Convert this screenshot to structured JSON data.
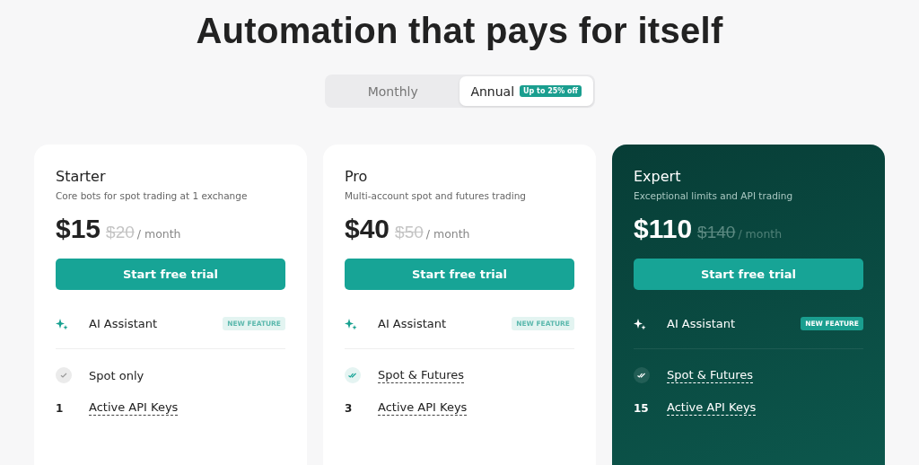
{
  "heading": "Automation that pays for itself",
  "billing": [
    {
      "label": "Monthly",
      "selected": false
    },
    {
      "label": "Annual",
      "selected": true,
      "badge": "Up to 25% off"
    }
  ],
  "plans": [
    {
      "name": "Starter",
      "tagline": "Core bots for spot trading at 1 exchange",
      "price": "$15",
      "old_price": "$20",
      "period": "/ month",
      "featured": false,
      "cta": "Start free trial",
      "ai": {
        "label": "AI Assistant",
        "badge": "NEW FEATURE"
      },
      "market": {
        "kind": "check",
        "label": "Spot only",
        "underlined": false
      },
      "keys": {
        "count": "1",
        "label": "Active API Keys"
      }
    },
    {
      "name": "Pro",
      "tagline": "Multi-account spot and futures trading",
      "price": "$40",
      "old_price": "$50",
      "period": "/ month",
      "featured": false,
      "cta": "Start free trial",
      "ai": {
        "label": "AI Assistant",
        "badge": "NEW FEATURE"
      },
      "market": {
        "kind": "double-check",
        "label": "Spot & Futures",
        "underlined": true
      },
      "keys": {
        "count": "3",
        "label": "Active API Keys"
      }
    },
    {
      "name": "Expert",
      "tagline": "Exceptional limits and API trading",
      "price": "$110",
      "old_price": "$140",
      "period": "/ month",
      "featured": true,
      "cta": "Start free trial",
      "ai": {
        "label": "AI Assistant",
        "badge": "NEW FEATURE"
      },
      "market": {
        "kind": "double-check",
        "label": "Spot & Futures",
        "underlined": true
      },
      "keys": {
        "count": "15",
        "label": "Active API Keys"
      }
    }
  ]
}
